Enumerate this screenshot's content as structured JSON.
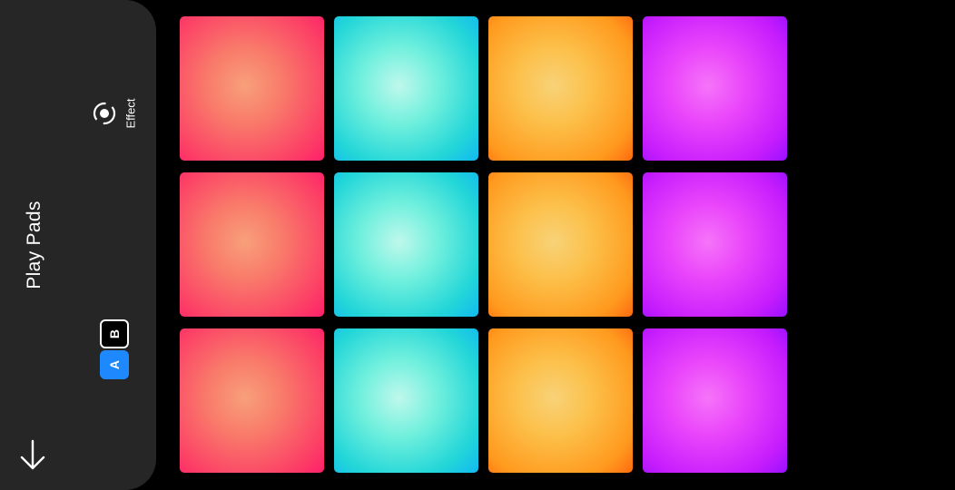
{
  "sidebar": {
    "title": "Play Pads",
    "effect_label": "Effect",
    "bank_switch": {
      "options": [
        "B",
        "A"
      ],
      "selected": "A"
    },
    "icons": {
      "effect": "effect-target-icon",
      "collapse": "arrow-down-icon"
    }
  },
  "pads": {
    "rows": 3,
    "columns": 4,
    "column_colors": [
      "red",
      "cyan",
      "orange",
      "purple"
    ],
    "palette": {
      "red": "#ff2f6a",
      "cyan": "#12c8e6",
      "orange": "#ff8a16",
      "purple": "#b116ff"
    }
  },
  "colors": {
    "background": "#000000",
    "sidebar": "#262626",
    "accent": "#1e88ff",
    "text": "#ffffff"
  }
}
